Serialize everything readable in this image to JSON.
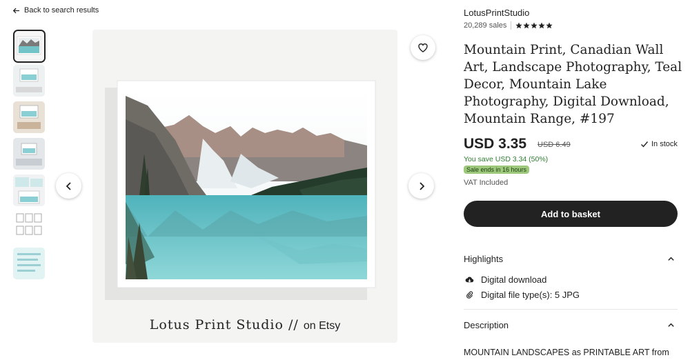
{
  "back": {
    "label": "Back to search results"
  },
  "thumbnails": [
    "thumb-1",
    "thumb-2",
    "thumb-3",
    "thumb-4",
    "thumb-5",
    "thumb-6",
    "thumb-7"
  ],
  "image": {
    "caption_main": "Lotus Print Studio",
    "caption_sep": "//",
    "caption_tail": "on Etsy"
  },
  "shop": {
    "name": "LotusPrintStudio",
    "sales": "20,289 sales",
    "rating": 5
  },
  "product": {
    "title": "Mountain Print, Canadian Wall Art, Landscape Photography, Teal Decor, Mountain Lake Photography, Digital Download, Mountain Range, #197",
    "price": "USD 3.35",
    "original_price": "USD 6.49",
    "stock": "In stock",
    "savings": "You save USD 3.34 (50%)",
    "sale_badge": "Sale ends in 16 hours",
    "vat": "VAT Included",
    "basket_label": "Add to basket"
  },
  "highlights": {
    "heading": "Highlights",
    "items": [
      {
        "icon": "cloud-download-icon",
        "text": "Digital download"
      },
      {
        "icon": "paperclip-icon",
        "text": "Digital file type(s): 5 JPG"
      }
    ]
  },
  "description": {
    "heading": "Description",
    "text": "MOUNTAIN LANDSCAPES as PRINTABLE ART from"
  },
  "colors": {
    "accent_green": "#2e7d32",
    "badge_green": "#9ec97c",
    "button_dark": "#222222"
  }
}
